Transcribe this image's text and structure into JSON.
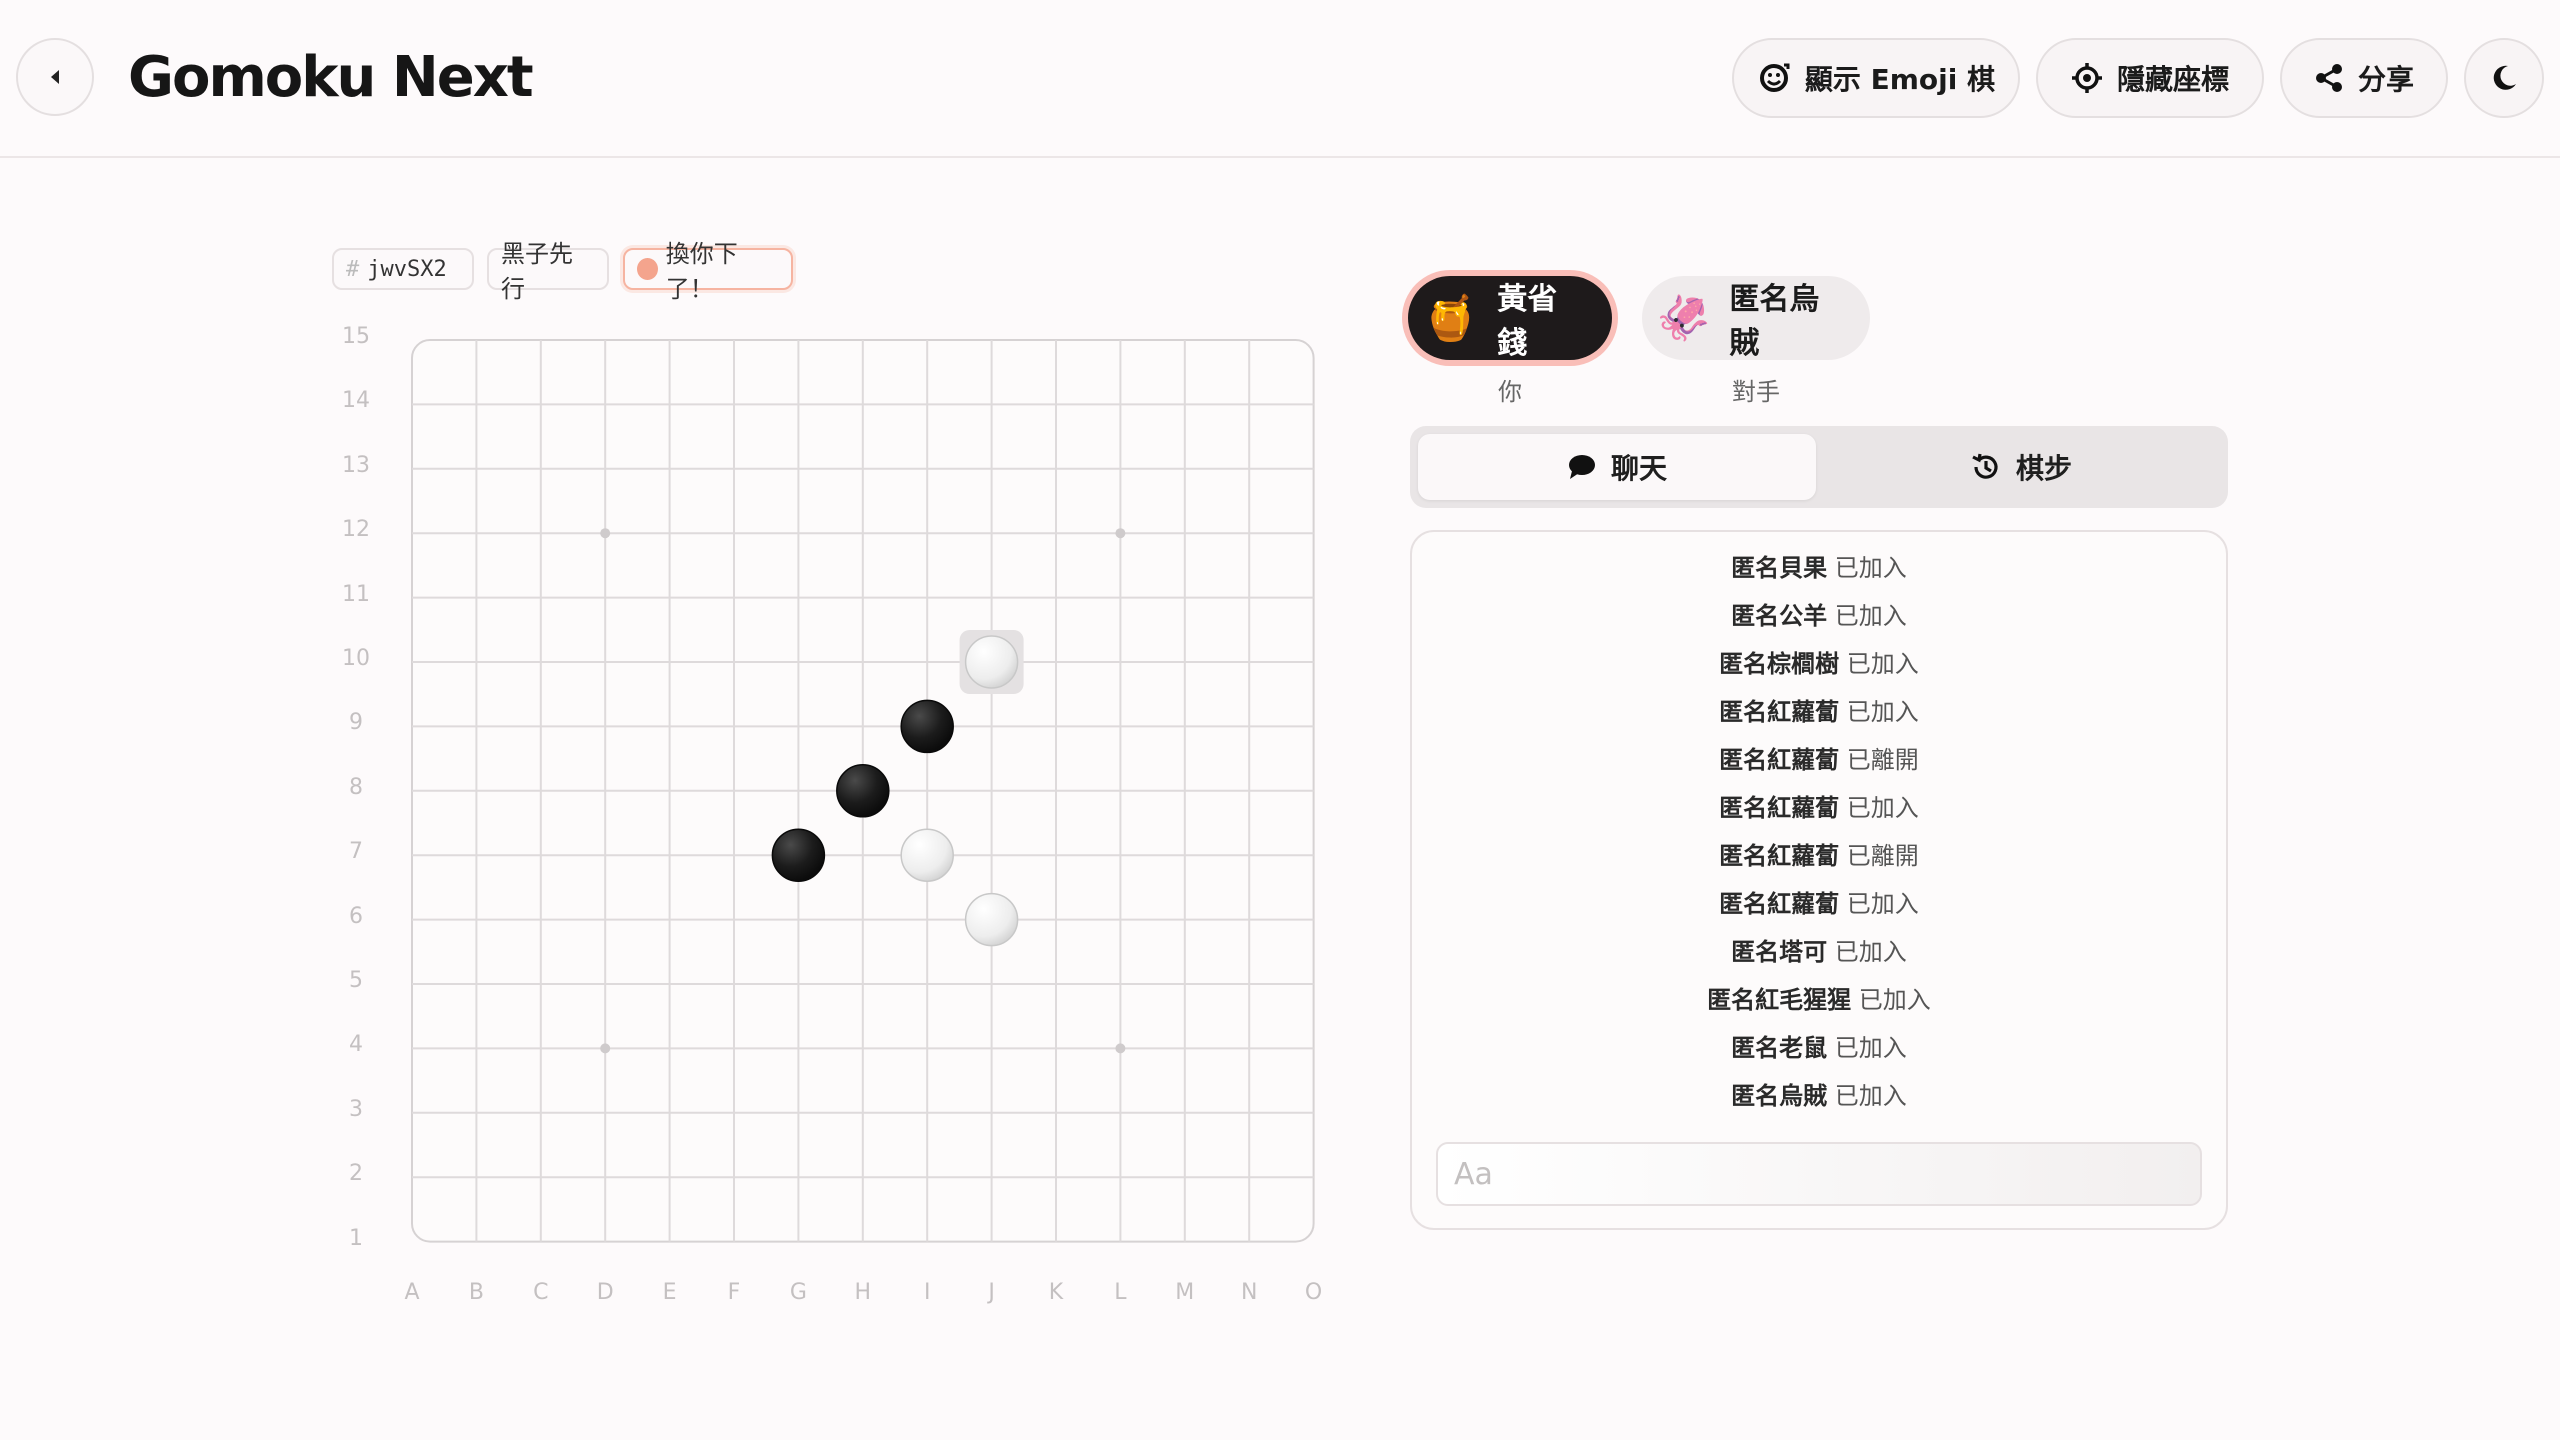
{
  "header": {
    "title": "Gomoku Next",
    "buttons": {
      "emoji_label": "顯示 Emoji 棋",
      "coords_label": "隱藏座標",
      "share_label": "分享"
    }
  },
  "game": {
    "room_id": "jwvSX2",
    "first_move": "黑子先行",
    "turn_status": "換你下了！"
  },
  "board": {
    "columns": [
      "A",
      "B",
      "C",
      "D",
      "E",
      "F",
      "G",
      "H",
      "I",
      "J",
      "K",
      "L",
      "M",
      "N",
      "O"
    ],
    "rows": [
      "15",
      "14",
      "13",
      "12",
      "11",
      "10",
      "9",
      "8",
      "7",
      "6",
      "5",
      "4",
      "3",
      "2",
      "1"
    ],
    "star_points": [
      "D12",
      "L12",
      "D4",
      "L4"
    ],
    "stones": [
      {
        "coord": "J10",
        "color": "white",
        "last": true
      },
      {
        "coord": "I9",
        "color": "black"
      },
      {
        "coord": "H8",
        "color": "black"
      },
      {
        "coord": "G7",
        "color": "black"
      },
      {
        "coord": "I7",
        "color": "white"
      },
      {
        "coord": "J6",
        "color": "white"
      }
    ]
  },
  "players": {
    "me": {
      "name": "黃省錢",
      "emoji": "🍯",
      "role": "你"
    },
    "opponent": {
      "name": "匿名烏賊",
      "emoji": "🦑",
      "role": "對手"
    }
  },
  "tabs": {
    "chat": "聊天",
    "moves": "棋步"
  },
  "chat": {
    "messages": [
      {
        "name": "匿名貝果",
        "action": "已加入"
      },
      {
        "name": "匿名公羊",
        "action": "已加入"
      },
      {
        "name": "匿名棕櫚樹",
        "action": "已加入"
      },
      {
        "name": "匿名紅蘿蔔",
        "action": "已加入"
      },
      {
        "name": "匿名紅蘿蔔",
        "action": "已離開"
      },
      {
        "name": "匿名紅蘿蔔",
        "action": "已加入"
      },
      {
        "name": "匿名紅蘿蔔",
        "action": "已離開"
      },
      {
        "name": "匿名紅蘿蔔",
        "action": "已加入"
      },
      {
        "name": "匿名塔可",
        "action": "已加入"
      },
      {
        "name": "匿名紅毛猩猩",
        "action": "已加入"
      },
      {
        "name": "匿名老鼠",
        "action": "已加入"
      },
      {
        "name": "匿名烏賊",
        "action": "已加入"
      }
    ],
    "placeholder": "Aa"
  },
  "colors": {
    "turn_accent": "#f4a48d",
    "black_stone": "#1a1a1a",
    "white_stone": "#f2f2f2",
    "my_badge_bg": "#1e1a1b"
  },
  "icons": {
    "back": "caret-left-icon",
    "emoji": "emoji-swap-icon",
    "coords": "crosshair-icon",
    "share": "share-icon",
    "theme": "moon-icon",
    "chat": "speech-bubble-icon",
    "moves": "history-icon"
  }
}
